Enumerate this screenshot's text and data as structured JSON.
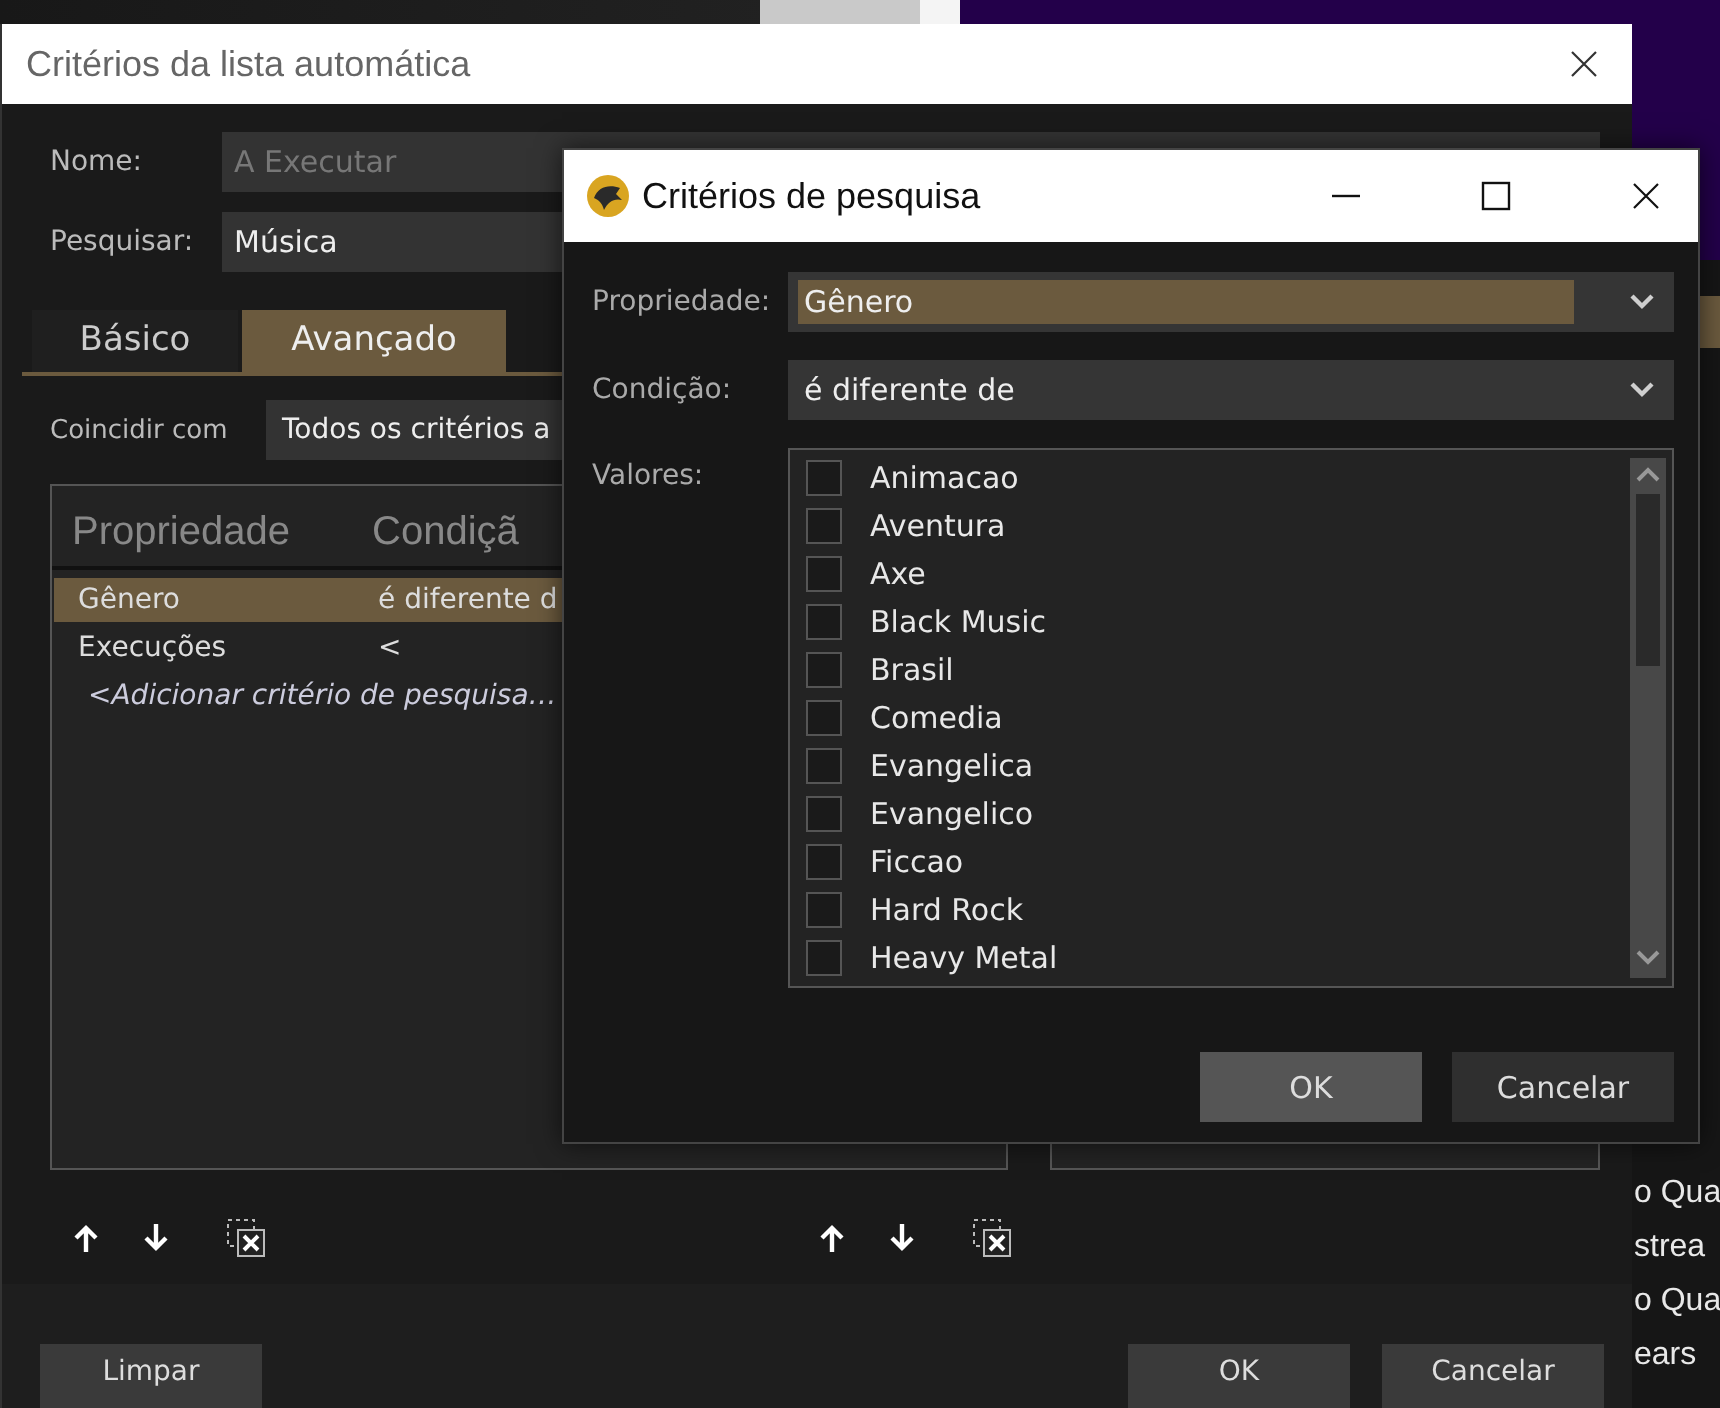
{
  "background_list": {
    "rows_below_dialog": [
      "o Qua",
      "strea",
      "o Qua",
      "ears"
    ]
  },
  "main_dialog": {
    "title": "Critérios da lista automática",
    "name_field": {
      "label": "Nome:",
      "value": "A Executar",
      "disabled": true
    },
    "search_field": {
      "label": "Pesquisar:",
      "value": "Música",
      "disabled": false
    },
    "tabs": [
      {
        "label": "Básico",
        "selected": false
      },
      {
        "label": "Avançado",
        "selected": true
      }
    ],
    "match": {
      "label": "Coincidir com",
      "value": "Todos os critérios a"
    },
    "criteria_table": {
      "columns": [
        "Propriedade",
        "Condiçã"
      ],
      "rows": [
        {
          "property": "Gênero",
          "condition": "é diferente d",
          "selected": true
        },
        {
          "property": "Execuções",
          "condition": "<",
          "selected": false
        }
      ],
      "add_row": "<Adicionar critério de pesquisa…"
    },
    "buttons": [
      {
        "label": "Limpar",
        "kind": "left"
      },
      {
        "label": "OK",
        "kind": "right"
      },
      {
        "label": "Cancelar",
        "kind": "right"
      }
    ]
  },
  "search_dialog": {
    "title": "Critérios de pesquisa",
    "property": {
      "label": "Propriedade:",
      "value": "Gênero",
      "focused": true
    },
    "condition": {
      "label": "Condição:",
      "value": "é diferente de",
      "focused": false
    },
    "values_label": "Valores:",
    "values": [
      {
        "label": "Animacao",
        "checked": false
      },
      {
        "label": "Aventura",
        "checked": false
      },
      {
        "label": "Axe",
        "checked": false
      },
      {
        "label": "Black Music",
        "checked": false
      },
      {
        "label": "Brasil",
        "checked": false
      },
      {
        "label": "Comedia",
        "checked": false
      },
      {
        "label": "Evangelica",
        "checked": false
      },
      {
        "label": "Evangelico",
        "checked": false
      },
      {
        "label": "Ficcao",
        "checked": false
      },
      {
        "label": "Hard Rock",
        "checked": false
      },
      {
        "label": "Heavy Metal",
        "checked": false
      }
    ],
    "buttons": [
      {
        "label": "OK",
        "default": true
      },
      {
        "label": "Cancelar",
        "default": false
      }
    ]
  }
}
